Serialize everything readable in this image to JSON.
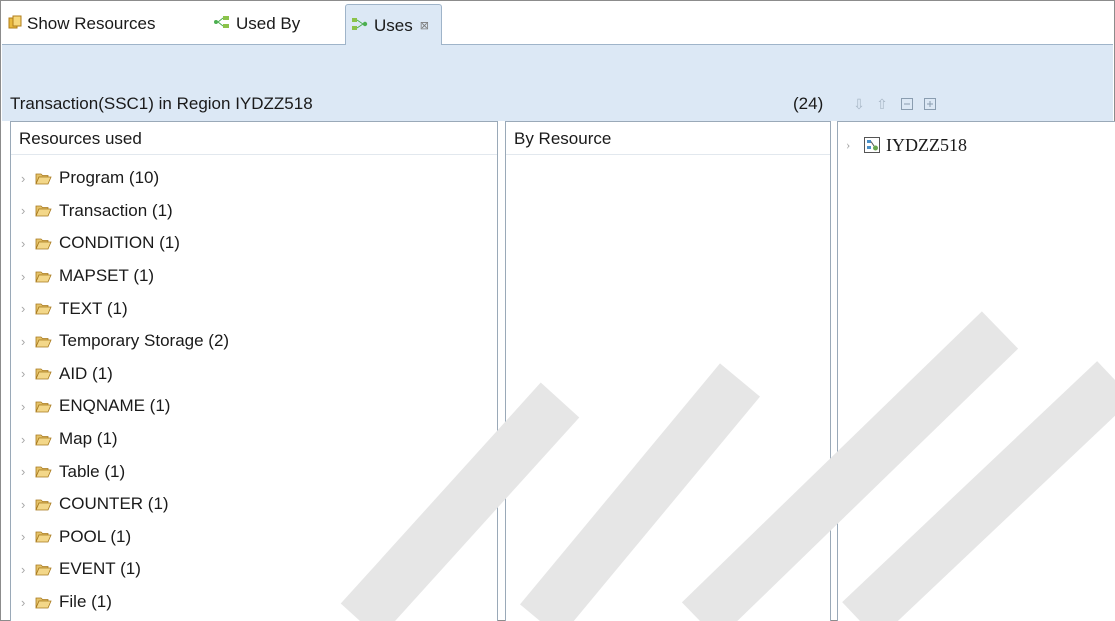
{
  "tabs": [
    {
      "label": "Show Resources",
      "icon": "resources-icon"
    },
    {
      "label": "Used By",
      "icon": "used-by-icon"
    },
    {
      "label": "Uses",
      "icon": "uses-icon",
      "active": true,
      "close_glyph": "⊠"
    }
  ],
  "header": {
    "title": "Transaction(SSC1) in Region IYDZZ518",
    "count": "(24)",
    "toolbar": [
      "move-down-icon",
      "move-up-icon",
      "collapse-all-icon",
      "expand-all-icon"
    ]
  },
  "left_panel": {
    "header": "Resources used",
    "items": [
      {
        "label": "Program  (10)"
      },
      {
        "label": "Transaction  (1)"
      },
      {
        "label": "CONDITION  (1)"
      },
      {
        "label": "MAPSET  (1)"
      },
      {
        "label": "TEXT  (1)"
      },
      {
        "label": "Temporary Storage  (2)"
      },
      {
        "label": "AID  (1)"
      },
      {
        "label": "ENQNAME  (1)"
      },
      {
        "label": "Map  (1)"
      },
      {
        "label": "Table  (1)"
      },
      {
        "label": "COUNTER  (1)"
      },
      {
        "label": "POOL  (1)"
      },
      {
        "label": "EVENT  (1)"
      },
      {
        "label": "File  (1)"
      }
    ]
  },
  "middle_panel": {
    "header": "By Resource"
  },
  "right_panel": {
    "items": [
      {
        "label": "IYDZZ518",
        "icon": "region-icon"
      }
    ]
  },
  "colors": {
    "band": "#dce8f5",
    "folder": "#b58a2a",
    "border": "#9aa9b8"
  }
}
